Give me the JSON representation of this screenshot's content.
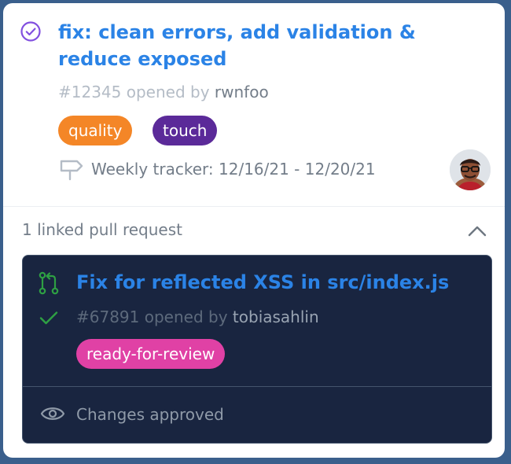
{
  "issue": {
    "status_icon": "issue-closed-check-icon",
    "title": "fix: clean errors, add validation & reduce exposed",
    "number": "#12345",
    "opened_by_text": "opened by",
    "author": "rwnfoo",
    "labels": [
      {
        "text": "quality",
        "color": "#f48627"
      },
      {
        "text": "touch",
        "color": "#5b2a99"
      }
    ],
    "milestone_icon": "milestone-signpost-icon",
    "milestone": "Weekly tracker: 12/16/21 - 12/20/21",
    "assignee_avatar": "avatar-icon"
  },
  "linked": {
    "header": "1 linked pull request",
    "toggle_icon": "chevron-up-icon"
  },
  "pull_request": {
    "icon": "pull-request-icon",
    "title": "Fix for reflected XSS in src/index.js",
    "check_icon": "check-icon",
    "number": "#67891",
    "opened_by_text": "opened by",
    "author": "tobiasahlin",
    "label": {
      "text": "ready-for-review",
      "color": "#e041a5"
    },
    "review_icon": "eye-icon",
    "review_status": "Changes approved"
  },
  "colors": {
    "accent": "#2b83e6",
    "frame": "#3a5f8c",
    "pr_background": "#192540",
    "success": "#2ea043",
    "closed_purple": "#8250df"
  }
}
